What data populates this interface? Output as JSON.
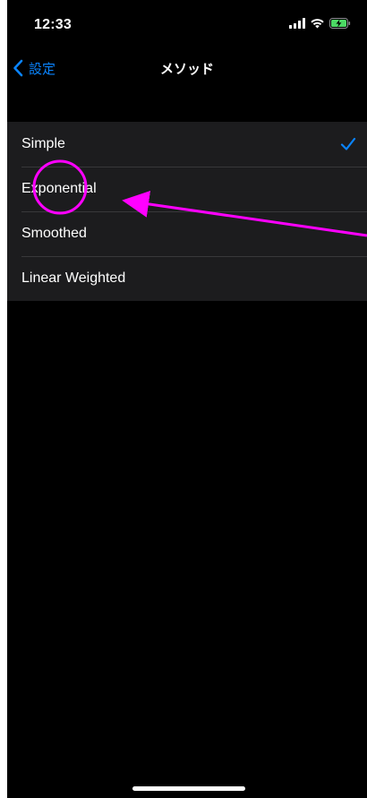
{
  "status_bar": {
    "time": "12:33",
    "icons": [
      "cellular-signal-icon",
      "wifi-icon",
      "battery-charging-icon"
    ],
    "battery_color": "#4cd964"
  },
  "nav": {
    "back_label": "設定",
    "title": "メソッド"
  },
  "list": {
    "items": [
      {
        "label": "Simple",
        "selected": true
      },
      {
        "label": "Exponential",
        "selected": false
      },
      {
        "label": "Smoothed",
        "selected": false
      },
      {
        "label": "Linear Weighted",
        "selected": false
      }
    ]
  },
  "colors": {
    "accent": "#0a84ff",
    "background": "#000000",
    "cell_background": "#1c1c1e",
    "separator": "#38383a",
    "annotation": "#ff00ff"
  },
  "icons": {
    "back": "chevron-left-icon",
    "selected": "checkmark-icon"
  }
}
